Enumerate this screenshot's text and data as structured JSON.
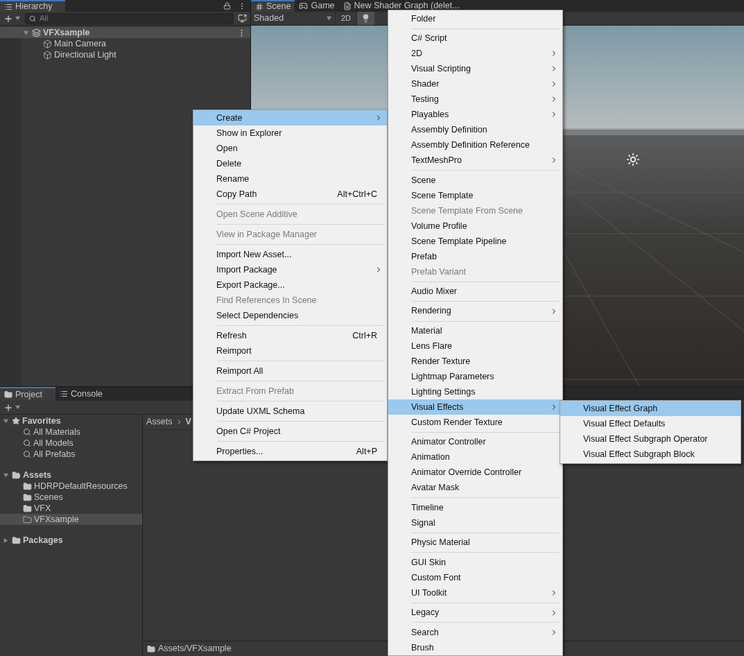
{
  "hierarchy": {
    "tab": "Hierarchy",
    "search": {
      "placeholder": "All"
    },
    "tree": [
      {
        "label": "VFXsample",
        "kind": "scene",
        "selected": true,
        "expanded": true,
        "children": [
          {
            "label": "Main Camera",
            "kind": "object",
            "selected": false
          },
          {
            "label": "Directional Light",
            "kind": "object",
            "selected": false
          }
        ]
      }
    ]
  },
  "scene_view": {
    "tabs": [
      {
        "label": "Scene",
        "kind": "scene",
        "selected": true
      },
      {
        "label": "Game",
        "kind": "game",
        "selected": false
      },
      {
        "label": "New Shader Graph (delet...",
        "kind": "shader",
        "selected": false
      }
    ],
    "shading": "Shaded",
    "mode_button": "2D",
    "lighting_on": true
  },
  "project": {
    "tabs": [
      {
        "label": "Project",
        "kind": "project",
        "selected": true
      },
      {
        "label": "Console",
        "kind": "console",
        "selected": false
      }
    ],
    "tree": [
      {
        "label": "Favorites",
        "kind": "favorites",
        "expanded": true,
        "selected": false,
        "children": [
          {
            "label": "All Materials",
            "kind": "search",
            "selected": false
          },
          {
            "label": "All Models",
            "kind": "search",
            "selected": false
          },
          {
            "label": "All Prefabs",
            "kind": "search",
            "selected": false
          }
        ]
      },
      {
        "label": "Assets",
        "kind": "folder",
        "expanded": true,
        "selected": false,
        "children": [
          {
            "label": "HDRPDefaultResources",
            "kind": "folder",
            "selected": false
          },
          {
            "label": "Scenes",
            "kind": "folder",
            "selected": false
          },
          {
            "label": "VFX",
            "kind": "folder",
            "selected": false
          },
          {
            "label": "VFXsample",
            "kind": "folder",
            "selected": true
          }
        ]
      },
      {
        "label": "Packages",
        "kind": "folder",
        "expanded": false,
        "selected": false
      }
    ],
    "breadcrumb": [
      "Assets",
      "V"
    ],
    "path": "Assets/VFXsample"
  },
  "context_menu": {
    "items": [
      {
        "kind": "item",
        "label": "Create",
        "submenu": true,
        "selected": true,
        "disabled": false
      },
      {
        "kind": "item",
        "label": "Show in Explorer",
        "selected": false,
        "disabled": false
      },
      {
        "kind": "item",
        "label": "Open",
        "selected": false,
        "disabled": false
      },
      {
        "kind": "item",
        "label": "Delete",
        "selected": false,
        "disabled": false
      },
      {
        "kind": "item",
        "label": "Rename",
        "selected": false,
        "disabled": false
      },
      {
        "kind": "item",
        "label": "Copy Path",
        "shortcut": "Alt+Ctrl+C",
        "selected": false,
        "disabled": false
      },
      {
        "kind": "separator"
      },
      {
        "kind": "item",
        "label": "Open Scene Additive",
        "selected": false,
        "disabled": true
      },
      {
        "kind": "separator"
      },
      {
        "kind": "item",
        "label": "View in Package Manager",
        "selected": false,
        "disabled": true
      },
      {
        "kind": "separator"
      },
      {
        "kind": "item",
        "label": "Import New Asset...",
        "selected": false,
        "disabled": false
      },
      {
        "kind": "item",
        "label": "Import Package",
        "submenu": true,
        "selected": false,
        "disabled": false
      },
      {
        "kind": "item",
        "label": "Export Package...",
        "selected": false,
        "disabled": false
      },
      {
        "kind": "item",
        "label": "Find References In Scene",
        "selected": false,
        "disabled": true
      },
      {
        "kind": "item",
        "label": "Select Dependencies",
        "selected": false,
        "disabled": false
      },
      {
        "kind": "separator"
      },
      {
        "kind": "item",
        "label": "Refresh",
        "shortcut": "Ctrl+R",
        "selected": false,
        "disabled": false
      },
      {
        "kind": "item",
        "label": "Reimport",
        "selected": false,
        "disabled": false
      },
      {
        "kind": "separator"
      },
      {
        "kind": "item",
        "label": "Reimport All",
        "selected": false,
        "disabled": false
      },
      {
        "kind": "separator"
      },
      {
        "kind": "item",
        "label": "Extract From Prefab",
        "selected": false,
        "disabled": true
      },
      {
        "kind": "separator"
      },
      {
        "kind": "item",
        "label": "Update UXML Schema",
        "selected": false,
        "disabled": false
      },
      {
        "kind": "separator"
      },
      {
        "kind": "item",
        "label": "Open C# Project",
        "selected": false,
        "disabled": false
      },
      {
        "kind": "separator"
      },
      {
        "kind": "item",
        "label": "Properties...",
        "shortcut": "Alt+P",
        "selected": false,
        "disabled": false
      }
    ]
  },
  "create_menu": {
    "items": [
      {
        "kind": "item",
        "label": "Folder",
        "selected": false,
        "disabled": false
      },
      {
        "kind": "separator"
      },
      {
        "kind": "item",
        "label": "C# Script",
        "selected": false,
        "disabled": false
      },
      {
        "kind": "item",
        "label": "2D",
        "submenu": true,
        "selected": false,
        "disabled": false
      },
      {
        "kind": "item",
        "label": "Visual Scripting",
        "submenu": true,
        "selected": false,
        "disabled": false
      },
      {
        "kind": "item",
        "label": "Shader",
        "submenu": true,
        "selected": false,
        "disabled": false
      },
      {
        "kind": "item",
        "label": "Testing",
        "submenu": true,
        "selected": false,
        "disabled": false
      },
      {
        "kind": "item",
        "label": "Playables",
        "submenu": true,
        "selected": false,
        "disabled": false
      },
      {
        "kind": "item",
        "label": "Assembly Definition",
        "selected": false,
        "disabled": false
      },
      {
        "kind": "item",
        "label": "Assembly Definition Reference",
        "selected": false,
        "disabled": false
      },
      {
        "kind": "item",
        "label": "TextMeshPro",
        "submenu": true,
        "selected": false,
        "disabled": false
      },
      {
        "kind": "separator"
      },
      {
        "kind": "item",
        "label": "Scene",
        "selected": false,
        "disabled": false
      },
      {
        "kind": "item",
        "label": "Scene Template",
        "selected": false,
        "disabled": false
      },
      {
        "kind": "item",
        "label": "Scene Template From Scene",
        "selected": false,
        "disabled": true
      },
      {
        "kind": "item",
        "label": "Volume Profile",
        "selected": false,
        "disabled": false
      },
      {
        "kind": "item",
        "label": "Scene Template Pipeline",
        "selected": false,
        "disabled": false
      },
      {
        "kind": "item",
        "label": "Prefab",
        "selected": false,
        "disabled": false
      },
      {
        "kind": "item",
        "label": "Prefab Variant",
        "selected": false,
        "disabled": true
      },
      {
        "kind": "separator"
      },
      {
        "kind": "item",
        "label": "Audio Mixer",
        "selected": false,
        "disabled": false
      },
      {
        "kind": "separator"
      },
      {
        "kind": "item",
        "label": "Rendering",
        "submenu": true,
        "selected": false,
        "disabled": false
      },
      {
        "kind": "separator"
      },
      {
        "kind": "item",
        "label": "Material",
        "selected": false,
        "disabled": false
      },
      {
        "kind": "item",
        "label": "Lens Flare",
        "selected": false,
        "disabled": false
      },
      {
        "kind": "item",
        "label": "Render Texture",
        "selected": false,
        "disabled": false
      },
      {
        "kind": "item",
        "label": "Lightmap Parameters",
        "selected": false,
        "disabled": false
      },
      {
        "kind": "item",
        "label": "Lighting Settings",
        "selected": false,
        "disabled": false
      },
      {
        "kind": "item",
        "label": "Visual Effects",
        "submenu": true,
        "selected": true,
        "disabled": false
      },
      {
        "kind": "item",
        "label": "Custom Render Texture",
        "selected": false,
        "disabled": false
      },
      {
        "kind": "separator"
      },
      {
        "kind": "item",
        "label": "Animator Controller",
        "selected": false,
        "disabled": false
      },
      {
        "kind": "item",
        "label": "Animation",
        "selected": false,
        "disabled": false
      },
      {
        "kind": "item",
        "label": "Animator Override Controller",
        "selected": false,
        "disabled": false
      },
      {
        "kind": "item",
        "label": "Avatar Mask",
        "selected": false,
        "disabled": false
      },
      {
        "kind": "separator"
      },
      {
        "kind": "item",
        "label": "Timeline",
        "selected": false,
        "disabled": false
      },
      {
        "kind": "item",
        "label": "Signal",
        "selected": false,
        "disabled": false
      },
      {
        "kind": "separator"
      },
      {
        "kind": "item",
        "label": "Physic Material",
        "selected": false,
        "disabled": false
      },
      {
        "kind": "separator"
      },
      {
        "kind": "item",
        "label": "GUI Skin",
        "selected": false,
        "disabled": false
      },
      {
        "kind": "item",
        "label": "Custom Font",
        "selected": false,
        "disabled": false
      },
      {
        "kind": "item",
        "label": "UI Toolkit",
        "submenu": true,
        "selected": false,
        "disabled": false
      },
      {
        "kind": "separator"
      },
      {
        "kind": "item",
        "label": "Legacy",
        "submenu": true,
        "selected": false,
        "disabled": false
      },
      {
        "kind": "separator"
      },
      {
        "kind": "item",
        "label": "Search",
        "submenu": true,
        "selected": false,
        "disabled": false
      },
      {
        "kind": "item",
        "label": "Brush",
        "selected": false,
        "disabled": false
      }
    ]
  },
  "visual_effects_menu": {
    "items": [
      {
        "kind": "item",
        "label": "Visual Effect Graph",
        "selected": true,
        "disabled": false
      },
      {
        "kind": "item",
        "label": "Visual Effect Defaults",
        "selected": false,
        "disabled": false
      },
      {
        "kind": "item",
        "label": "Visual Effect Subgraph Operator",
        "selected": false,
        "disabled": false
      },
      {
        "kind": "item",
        "label": "Visual Effect Subgraph Block",
        "selected": false,
        "disabled": false
      }
    ]
  }
}
